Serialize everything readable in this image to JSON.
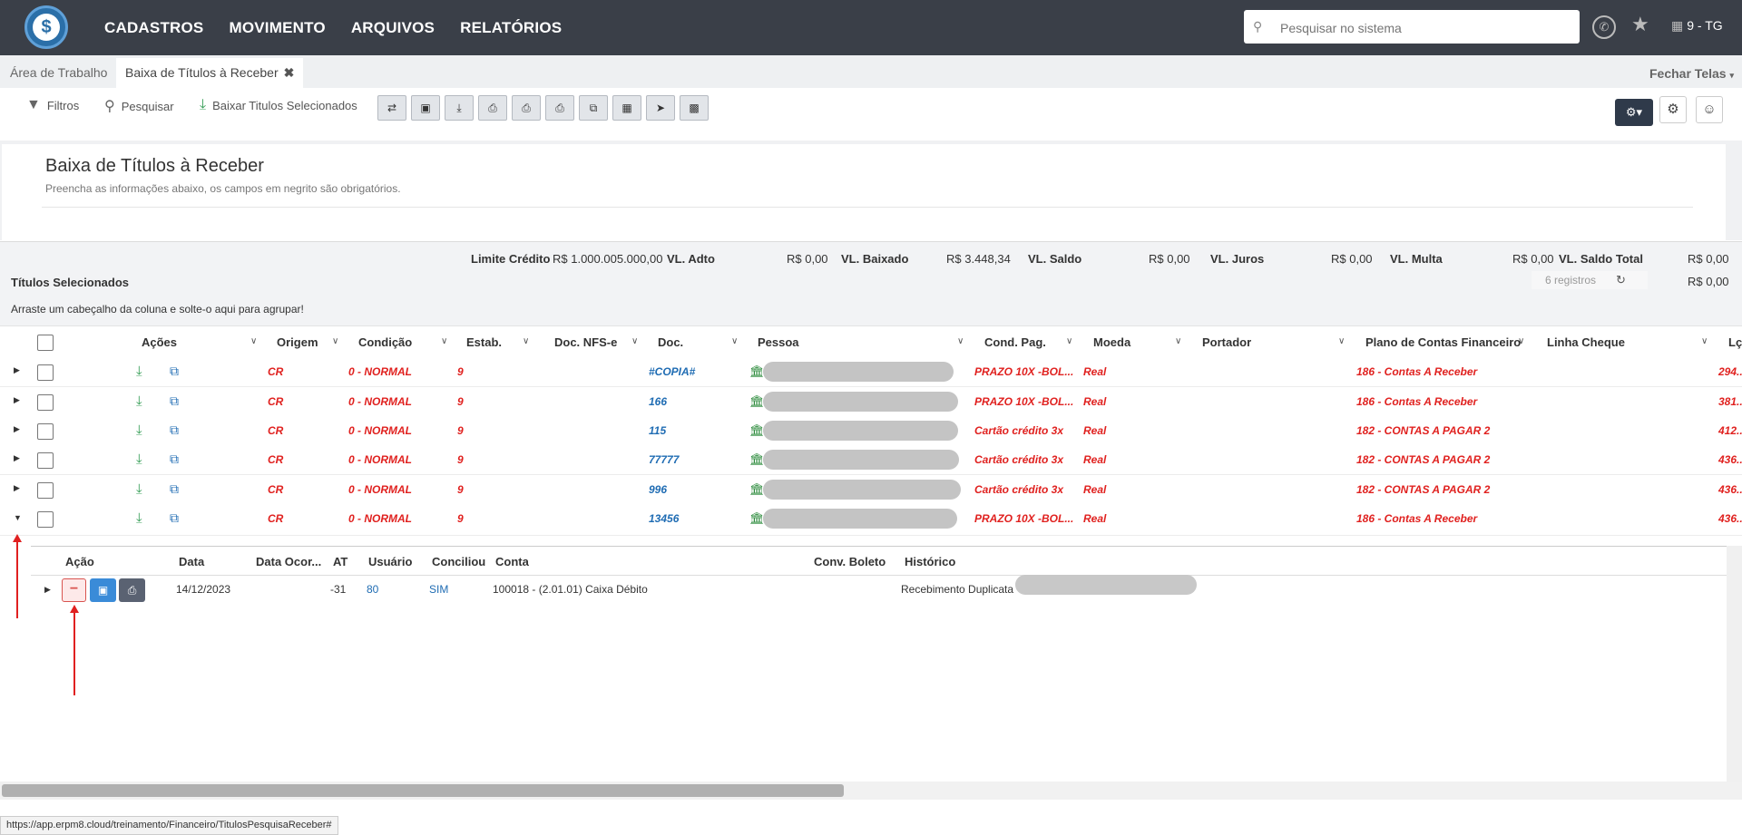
{
  "app": {
    "logo_symbol": "$"
  },
  "topmenu": [
    "CADASTROS",
    "MOVIMENTO",
    "ARQUIVOS",
    "RELATÓRIOS"
  ],
  "search": {
    "placeholder": "Pesquisar no sistema"
  },
  "company": "9 - TG",
  "tabs": [
    {
      "label": "Área de Trabalho"
    },
    {
      "label": "Baixa de Títulos à Receber"
    }
  ],
  "fechar_telas": "Fechar Telas",
  "toolbar": {
    "filtros": "Filtros",
    "pesquisar": "Pesquisar",
    "baixar": "Baixar Titulos Selecionados"
  },
  "form": {
    "title": "Baixa de Títulos à Receber",
    "subtitle": "Preencha as informações abaixo, os campos em negrito são obrigatórios."
  },
  "totals": {
    "limite_label": "Limite Crédito",
    "limite_value": "R$ 1.000.005.000,00",
    "adto_label": "VL. Adto",
    "adto_value": "R$ 0,00",
    "baixado_label": "VL. Baixado",
    "baixado_value": "R$ 3.448,34",
    "saldo_label": "VL. Saldo",
    "saldo_value": "R$ 0,00",
    "juros_label": "VL. Juros",
    "juros_value": "R$ 0,00",
    "multa_label": "VL. Multa",
    "multa_value": "R$ 0,00",
    "saldo_total_label": "VL. Saldo Total",
    "saldo_total_value": "R$ 0,00",
    "second_value": "R$ 0,00",
    "titulos_label": "Títulos Selecionados",
    "registros": "6 registros"
  },
  "group_hint": "Arraste um cabeçalho da coluna e solte-o aqui para agrupar!",
  "columns": [
    "Ações",
    "Origem",
    "Condição",
    "Estab.",
    "Doc. NFS-e",
    "Doc.",
    "Pessoa",
    "Cond. Pag.",
    "Moeda",
    "Portador",
    "Plano de Contas Financeiro",
    "Linha Cheque",
    "Lç"
  ],
  "rows": [
    {
      "origem": "CR",
      "condicao": "0 - NORMAL",
      "estab": "9",
      "doc": "#COPIA#",
      "cond_pag": "PRAZO 10X -BOL...",
      "moeda": "Real",
      "plano": "186 - Contas A Receber",
      "valor": "294..."
    },
    {
      "origem": "CR",
      "condicao": "0 - NORMAL",
      "estab": "9",
      "doc": "166",
      "cond_pag": "PRAZO 10X -BOL...",
      "moeda": "Real",
      "plano": "186 - Contas A Receber",
      "valor": "381..."
    },
    {
      "origem": "CR",
      "condicao": "0 - NORMAL",
      "estab": "9",
      "doc": "115",
      "cond_pag": "Cartão crédito 3x",
      "moeda": "Real",
      "plano": "182 - CONTAS A PAGAR 2",
      "valor": "412..."
    },
    {
      "origem": "CR",
      "condicao": "0 - NORMAL",
      "estab": "9",
      "doc": "77777",
      "cond_pag": "Cartão crédito 3x",
      "moeda": "Real",
      "plano": "182 - CONTAS A PAGAR 2",
      "valor": "436..."
    },
    {
      "origem": "CR",
      "condicao": "0 - NORMAL",
      "estab": "9",
      "doc": "996",
      "cond_pag": "Cartão crédito 3x",
      "moeda": "Real",
      "plano": "182 - CONTAS A PAGAR 2",
      "valor": "436..."
    },
    {
      "origem": "CR",
      "condicao": "0 - NORMAL",
      "estab": "9",
      "doc": "13456",
      "cond_pag": "PRAZO 10X -BOL...",
      "moeda": "Real",
      "plano": "186 - Contas A Receber",
      "valor": "436..."
    }
  ],
  "detail": {
    "columns": [
      "Ação",
      "Data",
      "Data Ocor...",
      "AT",
      "Usuário",
      "Conciliou",
      "Conta",
      "Conv. Boleto",
      "Histórico"
    ],
    "row": {
      "data": "14/12/2023",
      "at": "-31",
      "usuario": "80",
      "conciliou": "SIM",
      "conta": "100018 - (2.01.01) Caixa Débito",
      "historico": "Recebimento Duplicata"
    }
  },
  "status_url": "https://app.erpm8.cloud/treinamento/Financeiro/TitulosPesquisaReceber#"
}
